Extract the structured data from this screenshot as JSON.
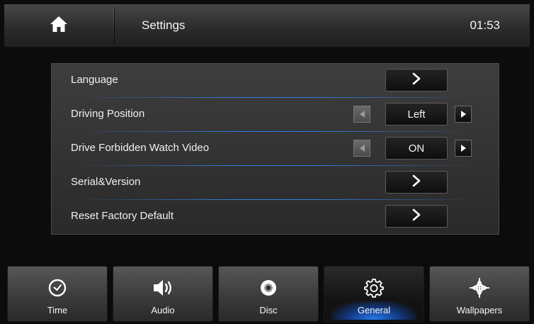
{
  "header": {
    "home_icon": "home-icon",
    "title": "Settings",
    "time": "01:53"
  },
  "settings": {
    "rows": [
      {
        "label": "Language",
        "control": "chevron",
        "icon": "chevron-right-icon"
      },
      {
        "label": "Driving Position",
        "control": "toggle",
        "value": "Left"
      },
      {
        "label": "Drive Forbidden Watch Video",
        "control": "toggle",
        "value": "ON"
      },
      {
        "label": "Serial&Version",
        "control": "chevron",
        "icon": "chevron-right-icon"
      },
      {
        "label": "Reset Factory Default",
        "control": "chevron",
        "icon": "chevron-right-icon"
      }
    ]
  },
  "tabs": [
    {
      "label": "Time",
      "icon": "clock-icon",
      "active": false
    },
    {
      "label": "Audio",
      "icon": "speaker-icon",
      "active": false
    },
    {
      "label": "Disc",
      "icon": "disc-icon",
      "active": false
    },
    {
      "label": "General",
      "icon": "gear-icon",
      "active": true
    },
    {
      "label": "Wallpapers",
      "icon": "wallpaper-icon",
      "active": false
    }
  ],
  "colors": {
    "accent": "#2f7ee0",
    "background": "#0c0c0c",
    "panel": "#333333"
  }
}
